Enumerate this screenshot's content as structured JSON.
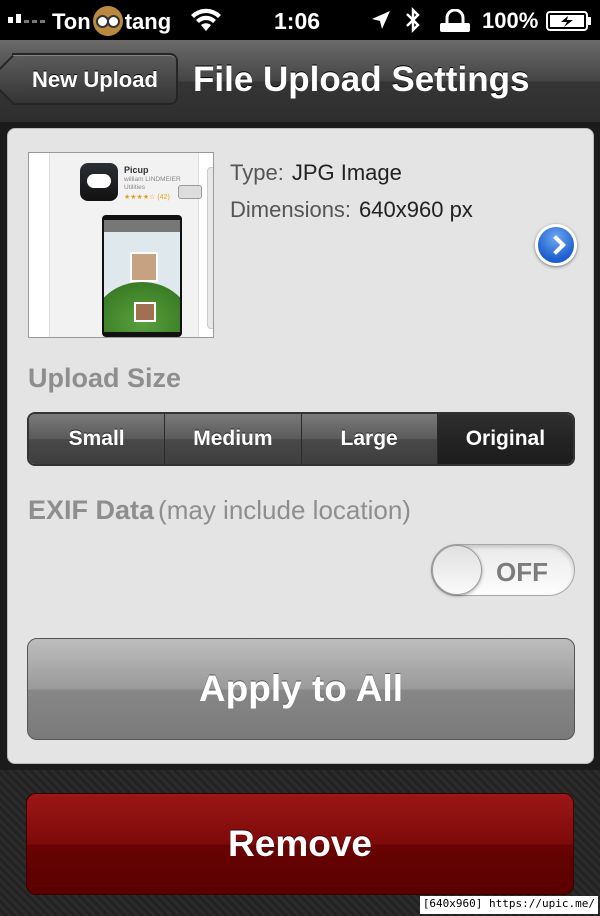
{
  "status_bar": {
    "carrier_prefix": "Ton",
    "carrier_suffix": "tang",
    "time": "1:06",
    "battery": "100%"
  },
  "navbar": {
    "back_label": "New Upload",
    "title": "File Upload Settings"
  },
  "file_info": {
    "type_label": "Type:",
    "type_value": "JPG Image",
    "dimensions_label": "Dimensions:",
    "dimensions_value": "640x960 px"
  },
  "thumbnail": {
    "app_name": "Picup",
    "developer": "william LINDMEIER",
    "category": "Utilities",
    "stars": "★★★★☆ (42)"
  },
  "upload_size": {
    "label": "Upload Size",
    "options": [
      "Small",
      "Medium",
      "Large",
      "Original"
    ],
    "selected": "Original"
  },
  "exif": {
    "label": "EXIF Data",
    "note": "(may include location)",
    "toggle_state": "OFF"
  },
  "buttons": {
    "apply_all": "Apply to All",
    "remove": "Remove"
  },
  "watermark": "[640x960] https://upic.me/",
  "colors": {
    "remove_red": "#7e0a0a",
    "detail_blue": "#1d5fd0"
  }
}
